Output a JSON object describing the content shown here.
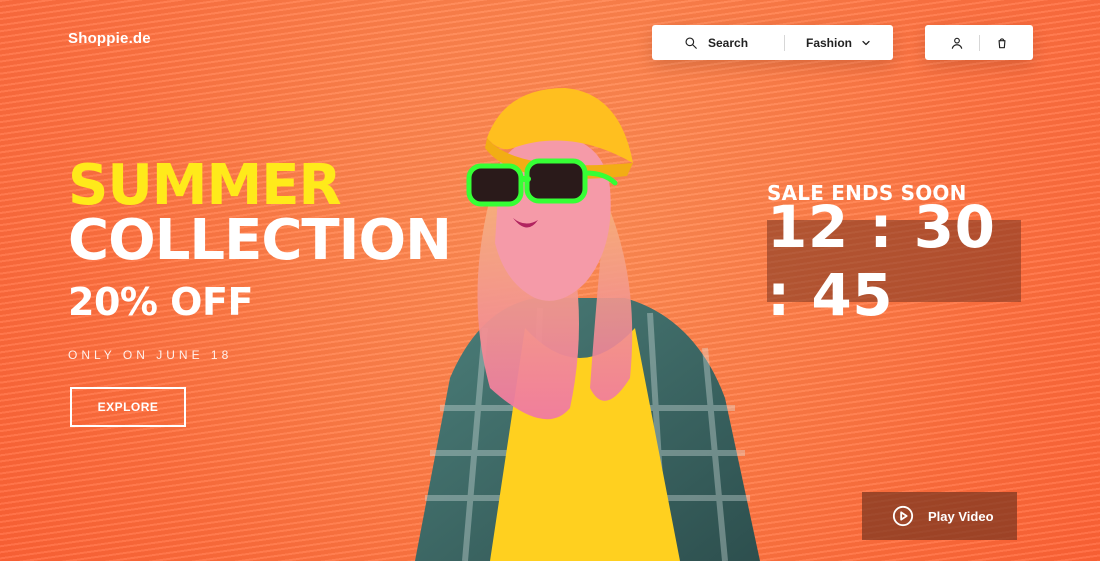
{
  "brand": {
    "name": "Shoppie.de"
  },
  "header": {
    "search_label": "Search",
    "category_label": "Fashion",
    "icons": {
      "search": "search-icon",
      "category_dropdown": "chevron-down-icon",
      "account": "user-icon",
      "cart": "cart-icon"
    }
  },
  "hero": {
    "title_line1": "SUMMER",
    "title_line2": "COLLECTION",
    "discount": "20% OFF",
    "date": "ONLY ON JUNE 18",
    "cta": "EXPLORE"
  },
  "sale": {
    "label": "SALE ENDS SOON",
    "time": "12 : 30 : 45"
  },
  "video": {
    "label": "Play Video",
    "icon": "play-icon"
  },
  "colors": {
    "background": "#ff6f3d",
    "accent_yellow": "#ffea1a",
    "panel_brown": "#7a3b24"
  }
}
